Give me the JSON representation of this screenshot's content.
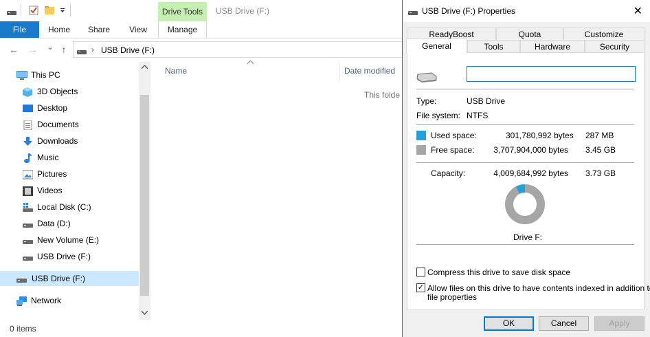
{
  "explorer": {
    "contextual_tab": "Drive Tools",
    "window_title": "USB Drive (F:)",
    "tabs": [
      "File",
      "Home",
      "Share",
      "View",
      "Manage"
    ],
    "address": "USB Drive (F:)",
    "address_sep": "›",
    "nav_icons": {
      "back": "←",
      "forward": "→",
      "recent": "⌄",
      "up": "↑"
    },
    "tree": [
      {
        "label": "This PC",
        "icon": "pc-icon"
      },
      {
        "label": "3D Objects",
        "icon": "3d-objects-icon"
      },
      {
        "label": "Desktop",
        "icon": "desktop-icon"
      },
      {
        "label": "Documents",
        "icon": "documents-icon"
      },
      {
        "label": "Downloads",
        "icon": "downloads-icon"
      },
      {
        "label": "Music",
        "icon": "music-icon"
      },
      {
        "label": "Pictures",
        "icon": "pictures-icon"
      },
      {
        "label": "Videos",
        "icon": "videos-icon"
      },
      {
        "label": "Local Disk (C:)",
        "icon": "drive-icon"
      },
      {
        "label": "Data (D:)",
        "icon": "drive-icon"
      },
      {
        "label": "New Volume (E:)",
        "icon": "drive-icon"
      },
      {
        "label": "USB Drive (F:)",
        "icon": "usb-drive-icon"
      },
      {
        "label": "USB Drive (F:)",
        "icon": "usb-drive-icon"
      },
      {
        "label": "Network",
        "icon": "network-icon"
      }
    ],
    "columns": {
      "name": "Name",
      "date_modified": "Date modified"
    },
    "empty_message": "This folde",
    "status": "0 items"
  },
  "dialog": {
    "title": "USB Drive (F:) Properties",
    "tabs_row1": [
      "ReadyBoost",
      "Quota",
      "Customize"
    ],
    "tabs_row2": [
      "General",
      "Tools",
      "Hardware",
      "Security"
    ],
    "active_tab": "General",
    "name_value": "",
    "type_label": "Type:",
    "type_value": "USB Drive",
    "fs_label": "File system:",
    "fs_value": "NTFS",
    "used_label": "Used space:",
    "used_bytes": "301,780,992 bytes",
    "used_short": "287 MB",
    "free_label": "Free space:",
    "free_bytes": "3,707,904,000 bytes",
    "free_short": "3.45 GB",
    "capacity_label": "Capacity:",
    "capacity_bytes": "4,009,684,992 bytes",
    "capacity_short": "3.73 GB",
    "used_fraction": 0.0753,
    "drive_label": "Drive F:",
    "compress_label": "Compress this drive to save disk space",
    "compress_checked": false,
    "index_label_line1": "Allow files on this drive to have contents indexed in addition to",
    "index_label_line2": "file properties",
    "index_checked": true,
    "ok": "OK",
    "cancel": "Cancel",
    "apply": "Apply",
    "close_glyph": "✕",
    "check_glyph": "✓",
    "colors": {
      "used": "#26a0da",
      "free": "#a6a6a6",
      "accent": "#1979ca",
      "selected": "#cce8ff"
    }
  }
}
